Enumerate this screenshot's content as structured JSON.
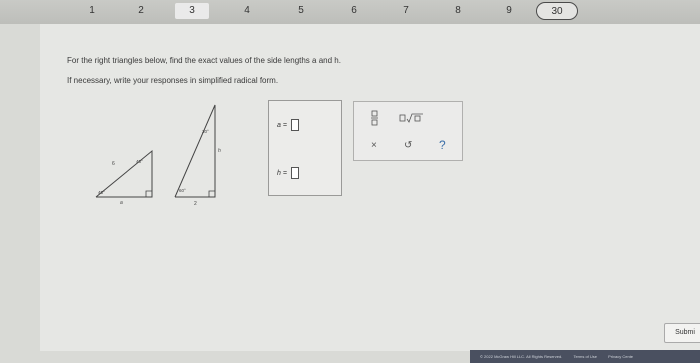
{
  "nav": {
    "questions": [
      "1",
      "2",
      "3",
      "4",
      "5",
      "6",
      "7",
      "8",
      "9"
    ],
    "current": "30"
  },
  "question": {
    "line1": "For the right triangles below, find the exact values of the side lengths a and h.",
    "line2": "If necessary, write your responses in simplified radical form."
  },
  "triangle1": {
    "hyp_label": "6",
    "angle_label": "45°",
    "angle_top_label": "45°",
    "base_label": "a"
  },
  "triangle2": {
    "angle_top_label": "30°",
    "side_label": "h",
    "angle_bottom_label": "60°",
    "base_label": "2"
  },
  "answers": {
    "a_label": "a =",
    "h_label": "h ="
  },
  "toolbox": {
    "fraction_icon": "fraction-icon",
    "radical_icon": "radical-icon",
    "clear_label": "×",
    "undo_label": "↺",
    "help_label": "?"
  },
  "submit_label": "Submi",
  "footer": {
    "copyright": "© 2022 McGraw Hill LLC. All Rights Reserved.",
    "terms": "Terms of Use",
    "privacy": "Privacy Cente"
  }
}
